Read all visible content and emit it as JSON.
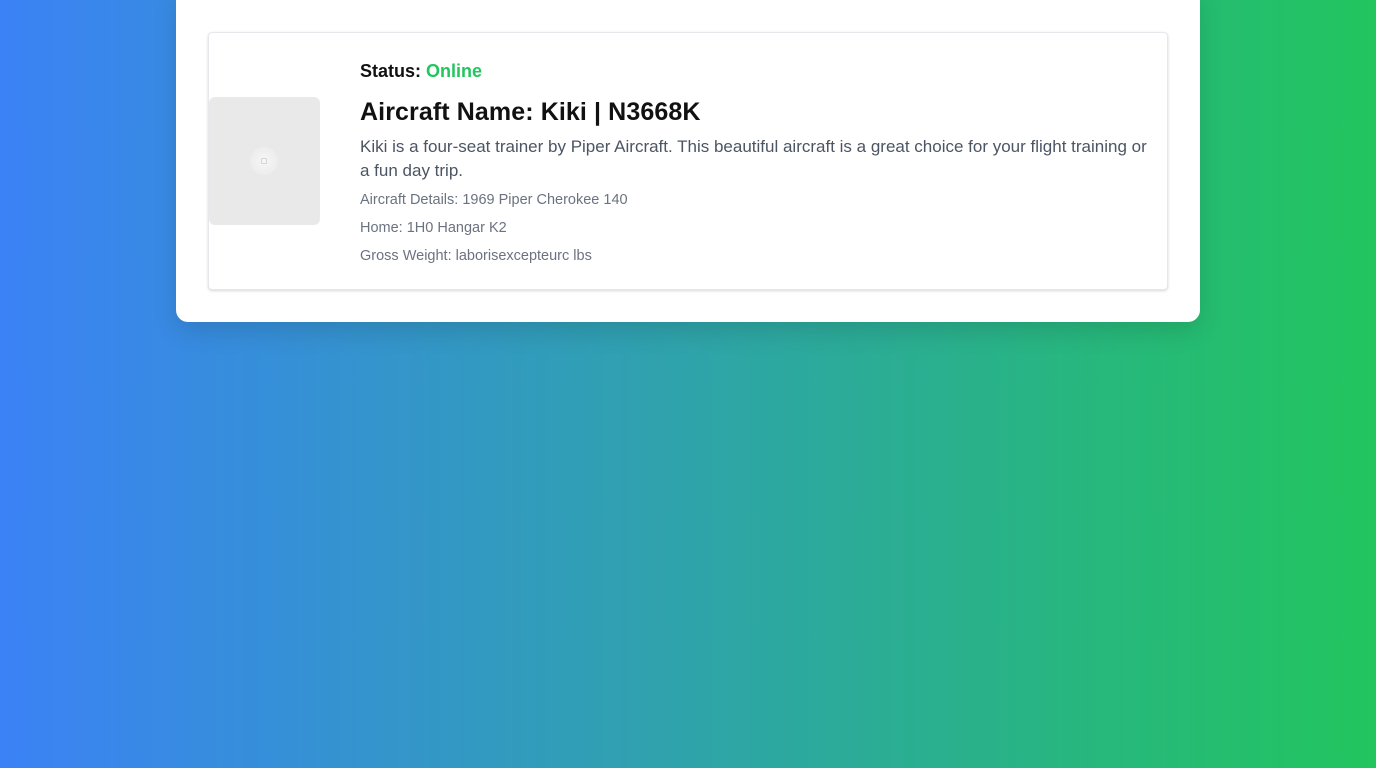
{
  "aircraft": {
    "status_label": "Status:",
    "status_value": "Online",
    "name": "Aircraft Name: Kiki | N3668K",
    "description": "Kiki is a four-seat trainer by Piper Aircraft. This beautiful aircraft is a great choice for your flight training or a fun day trip.",
    "details": "Aircraft Details: 1969 Piper Cherokee 140",
    "home": "Home: 1H0 Hangar K2",
    "gross_weight": "Gross Weight: laborisexcepteurc lbs"
  },
  "image": {
    "icon": "image-placeholder-icon"
  },
  "colors": {
    "status_online": "#22c55e",
    "gradient_start": "#3b82f6",
    "gradient_end": "#22c55e"
  }
}
